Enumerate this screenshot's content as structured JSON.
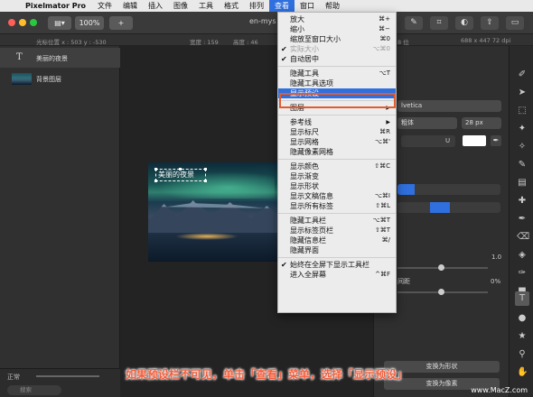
{
  "menubar": {
    "app_name": "Pixelmator Pro",
    "items": [
      "文件",
      "编辑",
      "插入",
      "图像",
      "工具",
      "格式",
      "排列",
      "查看",
      "窗口",
      "帮助"
    ]
  },
  "toolbar": {
    "zoom": "100%",
    "add": "+",
    "filename": "en-mys",
    "color_info": "688 x 447 72 dpi",
    "bit_depth": "8 位"
  },
  "infobar": {
    "cursor_position": "光标位置 x : 503   y : -530",
    "width": "宽度 : 159",
    "height": "高度 : 46"
  },
  "layers": [
    {
      "name": "美丽的夜景",
      "type": "text"
    },
    {
      "name": "背景图层",
      "type": "image"
    }
  ],
  "layers_footer": {
    "blend_mode": "正常",
    "search_placeholder": "搜索"
  },
  "canvas": {
    "text_layer": "美丽的夜景"
  },
  "right_panel": {
    "font": "lvetica",
    "font_style": "粗体",
    "font_size": "28 px",
    "slider1_value": "1.0",
    "slider2_label": "间距",
    "slider2_value": "0%",
    "convert_shape": "变换为形状",
    "convert_pixels": "变换为像素"
  },
  "view_menu": {
    "title": "查看",
    "items": [
      {
        "label": "放大",
        "shortcut": "⌘+"
      },
      {
        "label": "缩小",
        "shortcut": "⌘−"
      },
      {
        "label": "缩放至窗口大小",
        "shortcut": "⌘0"
      },
      {
        "label": "实际大小",
        "shortcut": "⌥⌘0",
        "disabled": true,
        "checked": true
      },
      {
        "label": "自动居中",
        "checked": true
      },
      {
        "label": "隐藏工具",
        "shortcut": "⌥T"
      },
      {
        "label": "隐藏工具选项"
      },
      {
        "label": "显示预设",
        "highlighted": true
      },
      {
        "label": "图层",
        "submenu": true
      },
      {
        "label": "参考线",
        "submenu": true
      },
      {
        "label": "显示标尺",
        "shortcut": "⌘R"
      },
      {
        "label": "显示网格",
        "shortcut": "⌥⌘'"
      },
      {
        "label": "隐藏像素网格"
      },
      {
        "label": "显示颜色",
        "shortcut": "⇧⌘C"
      },
      {
        "label": "显示渐变"
      },
      {
        "label": "显示形状"
      },
      {
        "label": "显示文稿信息",
        "shortcut": "⌥⌘I"
      },
      {
        "label": "显示所有标签",
        "shortcut": "⇧⌘L"
      },
      {
        "label": "隐藏工具栏",
        "shortcut": "⌥⌘T"
      },
      {
        "label": "显示标签页栏",
        "shortcut": "⇧⌘T"
      },
      {
        "label": "隐藏信息栏",
        "shortcut": "⌘/"
      },
      {
        "label": "隐藏界面"
      },
      {
        "label": "始终在全屏下显示工具栏",
        "checked": true
      },
      {
        "label": "进入全屏幕",
        "shortcut": "^⌘F"
      }
    ]
  },
  "caption": "如果预设栏不可见，单击「查看」菜单，选择「显示预设」",
  "watermark": "www.MacZ.com"
}
